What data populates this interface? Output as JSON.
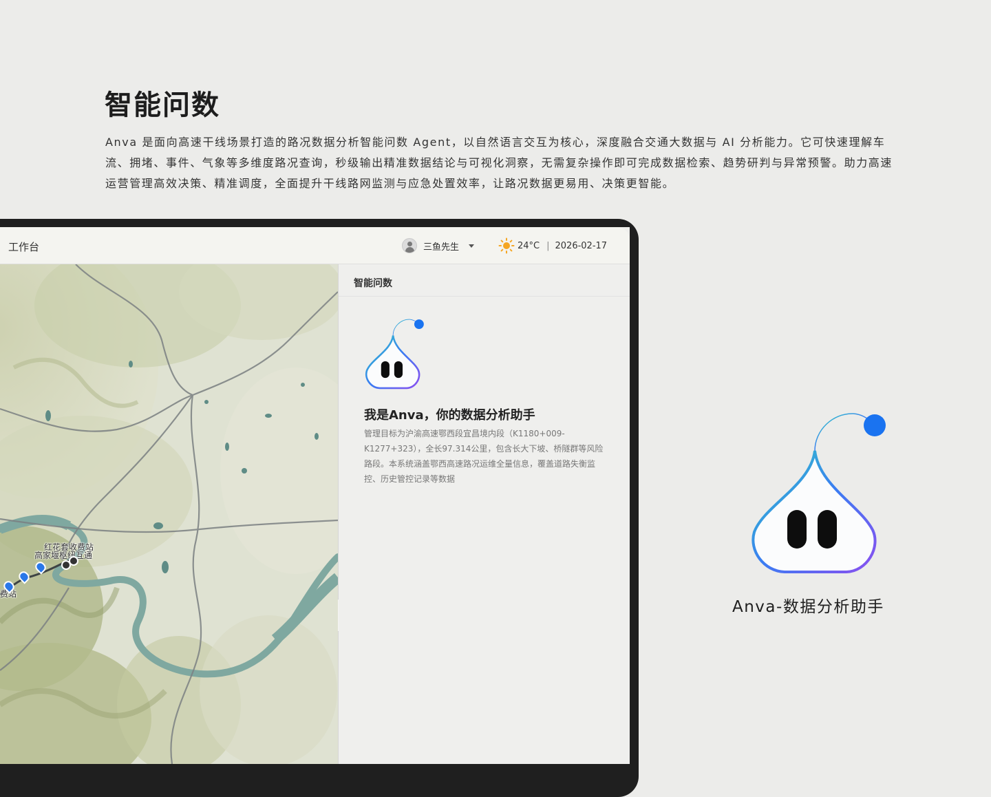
{
  "page": {
    "title": "智能问数",
    "description": "Anva 是面向高速干线场景打造的路况数据分析智能问数 Agent，以自然语言交互为核心，深度融合交通大数据与 AI 分析能力。它可快速理解车流、拥堵、事件、气象等多维度路况查询，秒级输出精准数据结论与可视化洞察，无需复杂操作即可完成数据检索、趋势研判与异常预警。助力高速运营管理高效决策、精准调度，全面提升干线路网监测与应急处置效率，让路况数据更易用、决策更智能。"
  },
  "topbar": {
    "workbench": "工作台",
    "user_name": "三鱼先生",
    "temperature": "24°C",
    "separator": "|",
    "date": "2026-02-17"
  },
  "map": {
    "labels": [
      "红花套收费站",
      "高家堰枢纽互通",
      "费站"
    ]
  },
  "panel": {
    "title": "智能问数",
    "greeting": "我是Anva，你的数据分析助手",
    "intro": "管理目标为沪渝高速鄂西段宜昌境内段（K1180+009-K1277+323），全长97.314公里，包含长大下坡、桥隧群等风险路段。本系统涵盖鄂西高速路况运维全量信息，覆盖道路失衡监控、历史管控记录等数据"
  },
  "brand": {
    "caption": "Anva-数据分析助手",
    "accent": "#1a73f0"
  }
}
